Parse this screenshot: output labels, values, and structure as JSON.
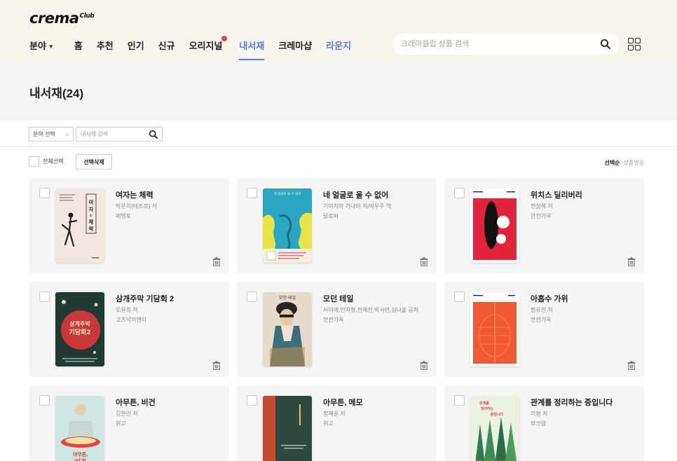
{
  "logo": {
    "name": "crema",
    "suffix": "Club"
  },
  "nav": {
    "field": "분야",
    "items": [
      "홈",
      "추천",
      "인기",
      "신규",
      "오리지널"
    ],
    "library": "내서재",
    "cremashop": "크레마샵",
    "lounge": "라운지"
  },
  "search": {
    "placeholder": "크레마클럽 상품 검색"
  },
  "page": {
    "title": "내서재(24)"
  },
  "filter": {
    "field_select": "분야 선택",
    "search_placeholder": "내서재 검색"
  },
  "toolbar": {
    "select_all": "전체선택",
    "delete_selected": "선택삭제",
    "sort_selected": "선택순",
    "sort_name": "상품명순"
  },
  "books": [
    {
      "title": "여자는 체력",
      "author": "박은지(테조로) 저",
      "publisher": "메멘토"
    },
    {
      "title": "네 얼굴로 울 수 없어",
      "author": "기미지마 가나타 저/박우주 역",
      "publisher": "달로와"
    },
    {
      "title": "위치스 딜리버리",
      "author": "전삼혜 저",
      "publisher": "안전가옥"
    },
    {
      "title": "삼개주막 기담회 2",
      "author": "오윤희 저",
      "publisher": "고즈넉이엔티"
    },
    {
      "title": "모던 테일",
      "author": "서미애,민지형,전혜진,박서련,심너울 공저",
      "publisher": "안전가옥"
    },
    {
      "title": "아홉수 가위",
      "author": "범유진 저",
      "publisher": "안전가옥"
    },
    {
      "title": "아무튼, 비건",
      "author": "김한민 저",
      "publisher": "위고"
    },
    {
      "title": "아무튼, 메모",
      "author": "정혜윤 저",
      "publisher": "위고"
    },
    {
      "title": "관계를 정리하는 중입니다",
      "author": "이평 저",
      "publisher": "부크럼"
    }
  ],
  "covers": {
    "1_vertical_title": "여자는 체력",
    "2_top_text": "네 얼굴로 울 수 없어",
    "4_title": "삼개주막 기담회2",
    "5_title": "모던 테일",
    "7_title": "아무튼, 비건",
    "9_title": "관계를 정리하는 중입니다"
  },
  "colors": {
    "accent": "#5a7bd8",
    "badge": "#e8434a",
    "header_bg": "#f7f5ee",
    "card_bg": "#f5f5f5"
  }
}
